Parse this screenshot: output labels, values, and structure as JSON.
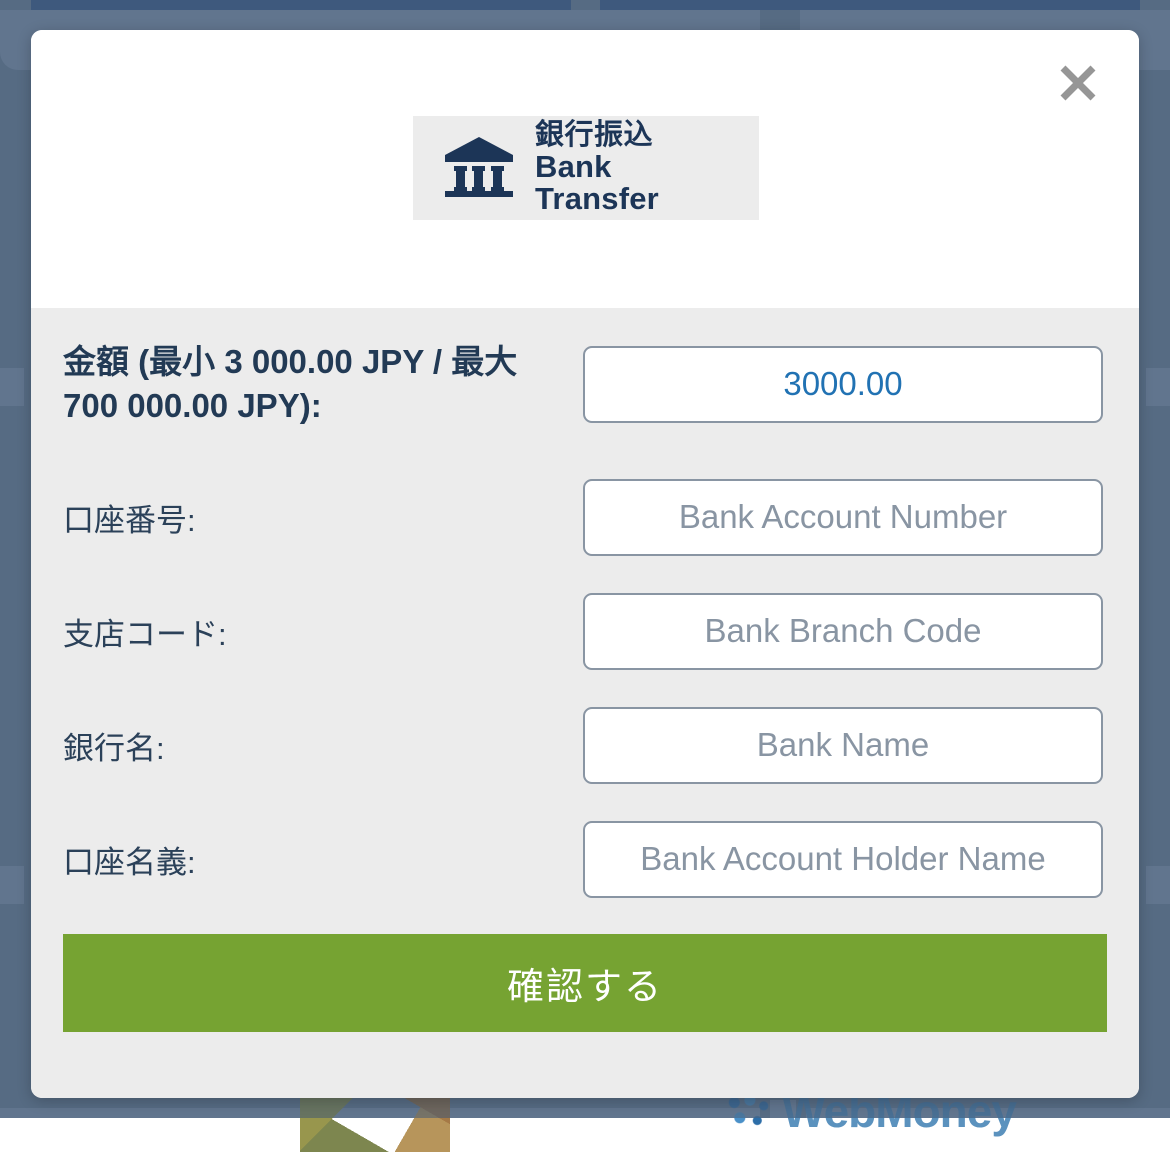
{
  "background": {
    "overlay_color": "#64788f",
    "card_header_color": "#2f5180",
    "logos": [
      {
        "name": "geometric-logo",
        "label": ""
      },
      {
        "name": "webmoney-logo",
        "label": "WebMoney"
      }
    ]
  },
  "modal": {
    "close_label": "×",
    "brand": {
      "icon": "bank-building-icon",
      "name_jp": "銀行振込",
      "name_en": "Bank Transfer",
      "color": "#1c3557"
    },
    "fields": [
      {
        "name": "amount",
        "label": "金額 (最小 3 000.00 JPY / 最大 700 000.00 JPY):",
        "value": "3000.00",
        "placeholder": "",
        "bold": true
      },
      {
        "name": "bank-account-number",
        "label": "口座番号:",
        "value": "",
        "placeholder": "Bank Account Number",
        "bold": false
      },
      {
        "name": "bank-branch-code",
        "label": "支店コード:",
        "value": "",
        "placeholder": "Bank Branch Code",
        "bold": false
      },
      {
        "name": "bank-name",
        "label": "銀行名:",
        "value": "",
        "placeholder": "Bank Name",
        "bold": false
      },
      {
        "name": "bank-account-holder-name",
        "label": "口座名義:",
        "value": "",
        "placeholder": "Bank Account Holder Name",
        "bold": false
      }
    ],
    "submit_label": "確認する",
    "submit_color": "#76a332",
    "input_text_color": "#2172b3",
    "input_border_color": "#8995a3",
    "body_background": "#ececec"
  }
}
